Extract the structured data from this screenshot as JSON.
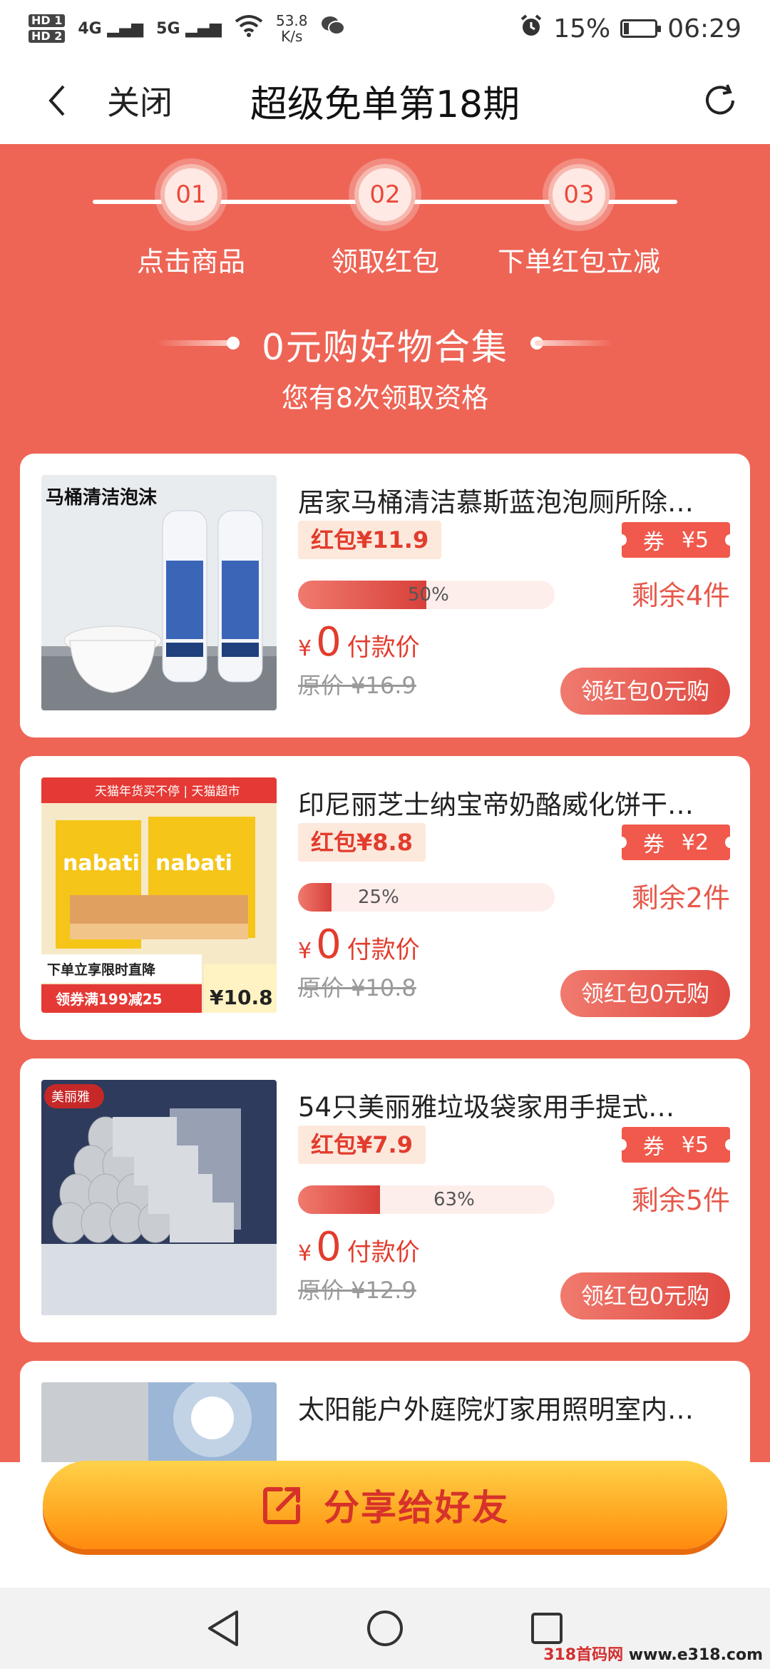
{
  "status_bar": {
    "hd1": "HD 1",
    "hd2": "HD 2",
    "signal1": "4G",
    "signal2": "5G",
    "speed_value": "53.8",
    "speed_unit": "K/s",
    "battery": "15%",
    "time": "06:29"
  },
  "nav": {
    "close_label": "关闭",
    "title": "超级免单第18期"
  },
  "steps": [
    {
      "num": "01",
      "label": "点击商品"
    },
    {
      "num": "02",
      "label": "领取红包"
    },
    {
      "num": "03",
      "label": "下单红包立减"
    }
  ],
  "collection": {
    "title": "0元购好物合集",
    "subtitle": "您有8次领取资格"
  },
  "products": [
    {
      "title": "居家马桶清洁慕斯蓝泡泡厕所除…",
      "red_packet": "红包¥11.9",
      "coupon_label": "券",
      "coupon_value": "¥5",
      "progress_percent": 50,
      "progress_text": "50%",
      "remaining": "剩余4件",
      "price_currency": "¥",
      "price_value": "0",
      "price_label": "付款价",
      "original_price": "原价 ¥16.9",
      "button_label": "领红包0元购",
      "image_text": "马桶清洁泡沫"
    },
    {
      "title": "印尼丽芝士纳宝帝奶酪威化饼干…",
      "red_packet": "红包¥8.8",
      "coupon_label": "券",
      "coupon_value": "¥2",
      "progress_percent": 25,
      "progress_text": "25%",
      "remaining": "剩余2件",
      "price_currency": "¥",
      "price_value": "0",
      "price_label": "付款价",
      "original_price": "原价 ¥10.8",
      "button_label": "领红包0元购",
      "image_text": "nabati",
      "image_banner": "天猫年货买不停 | 天猫超市",
      "image_promo": "下单立享限时直降",
      "image_coupon": "领券满199减25",
      "image_price": "¥10.8"
    },
    {
      "title": "54只美丽雅垃圾袋家用手提式…",
      "red_packet": "红包¥7.9",
      "coupon_label": "券",
      "coupon_value": "¥5",
      "progress_percent": 63,
      "progress_text": "63%",
      "remaining": "剩余5件",
      "price_currency": "¥",
      "price_value": "0",
      "price_label": "付款价",
      "original_price": "原价 ¥12.9",
      "button_label": "领红包0元购",
      "image_text": "美丽雅"
    },
    {
      "title": "太阳能户外庭院灯家用照明室内…"
    }
  ],
  "share": {
    "label": "分享给好友"
  },
  "watermark": {
    "part1": "318首码网",
    "part2": "www.e318.com"
  },
  "colors": {
    "main_bg": "#ee6556",
    "accent_red": "#e23c2d",
    "share_orange": "#ffa11c"
  }
}
